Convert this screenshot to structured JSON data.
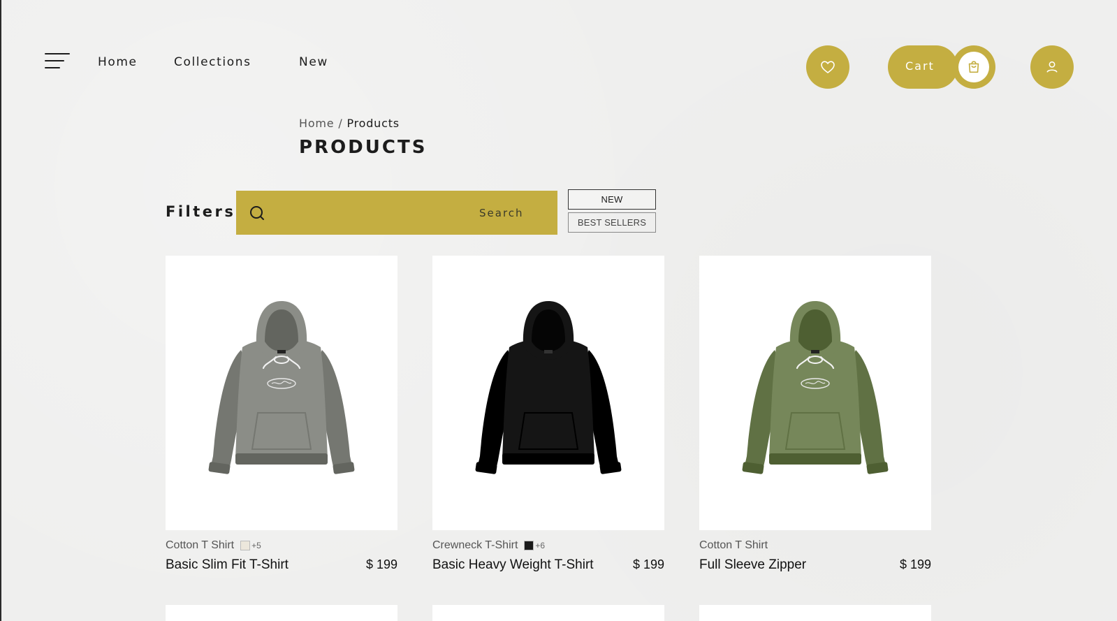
{
  "nav": {
    "links": [
      "Home",
      "Collections",
      "New"
    ]
  },
  "header_actions": {
    "cart_label": "Cart",
    "icons": [
      "heart-icon",
      "shopping-bag-icon",
      "user-icon"
    ]
  },
  "breadcrumb": {
    "home": "Home",
    "separator": "/",
    "current": "Products"
  },
  "page_title": "PRODUCTS",
  "filters": {
    "label": "Filters",
    "search_placeholder": "",
    "search_button": "Search",
    "tags": [
      "NEW",
      "BEST SELLERS"
    ]
  },
  "products": [
    {
      "category": "Cotton T Shirt",
      "swatch_color": "#ece7dc",
      "more_colors": "+5",
      "name": "Basic Slim Fit T-Shirt",
      "price": "$ 199",
      "hoodie_color": "#8b8d87"
    },
    {
      "category": "Crewneck T-Shirt",
      "swatch_color": "#1a1a1a",
      "more_colors": "+6",
      "name": "Basic Heavy Weight T-Shirt",
      "price": "$ 199",
      "hoodie_color": "#151515"
    },
    {
      "category": "Cotton T Shirt",
      "name": "Full Sleeve Zipper",
      "price": "$ 199",
      "hoodie_color": "#76875a"
    }
  ],
  "colors": {
    "accent": "#c4ae41",
    "background": "#efefee",
    "card": "#ffffff"
  }
}
